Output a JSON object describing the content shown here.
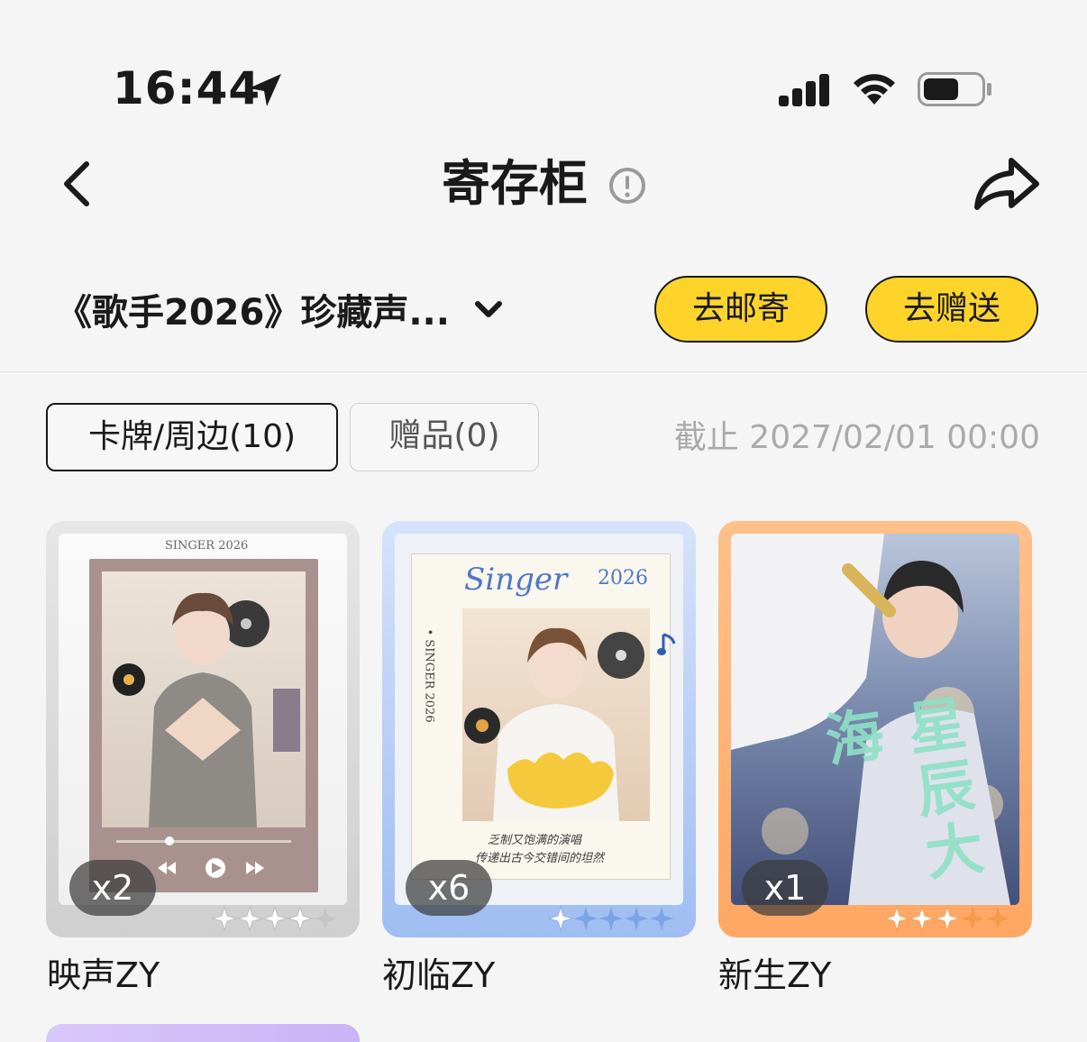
{
  "status_bar": {
    "time": "16:44"
  },
  "nav": {
    "title": "寄存柜"
  },
  "series": {
    "label": "《歌手2026》珍藏声..."
  },
  "actions": {
    "mail_label": "去邮寄",
    "gift_label": "去赠送"
  },
  "tabs": [
    {
      "label": "卡牌/周边(10)",
      "selected": true
    },
    {
      "label": "赠品(0)",
      "selected": false
    }
  ],
  "deadline": "截止 2027/02/01 00:00",
  "cards": [
    {
      "name": "映声ZY",
      "count": "x2",
      "stars": 4,
      "header_text": "SINGER 2026"
    },
    {
      "name": "初临ZY",
      "count": "x6",
      "stars": 1,
      "header_left": "Singer",
      "header_right": "2026",
      "side_text": "• SINGER 2026",
      "caption_line1": "乏制又饱满的演唱",
      "caption_line2": "传递出古今交错间的坦然"
    },
    {
      "name": "新生ZY",
      "count": "x1",
      "stars": 3,
      "art_text": "星辰大海"
    }
  ]
}
